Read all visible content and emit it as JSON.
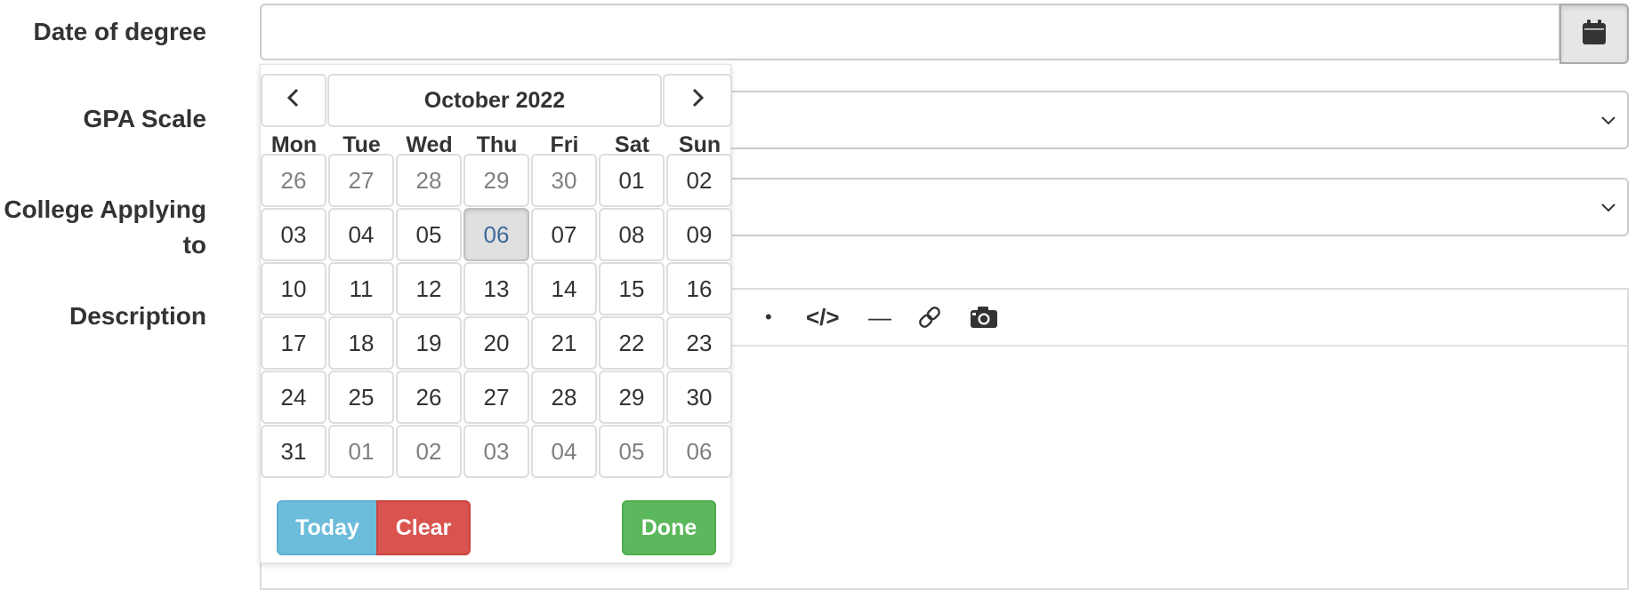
{
  "form": {
    "date_label": "Date of degree",
    "date_value": "",
    "gpa_label": "GPA Scale",
    "gpa_value": "",
    "college_label_line1": "College Applying",
    "college_label_line2": "to",
    "college_value": "",
    "description_label": "Description"
  },
  "editor": {
    "toolbar": {
      "bullet": "•",
      "code": "</>",
      "hr": "—",
      "link": "🔗",
      "image": "📷"
    }
  },
  "datepicker": {
    "prev_glyph": "‹",
    "next_glyph": "›",
    "month_year": "October 2022",
    "weekdays": [
      "Mon",
      "Tue",
      "Wed",
      "Thu",
      "Fri",
      "Sat",
      "Sun"
    ],
    "weeks": [
      [
        "26",
        "27",
        "28",
        "29",
        "30",
        "01",
        "02"
      ],
      [
        "03",
        "04",
        "05",
        "06",
        "07",
        "08",
        "09"
      ],
      [
        "10",
        "11",
        "12",
        "13",
        "14",
        "15",
        "16"
      ],
      [
        "17",
        "18",
        "19",
        "20",
        "21",
        "22",
        "23"
      ],
      [
        "24",
        "25",
        "26",
        "27",
        "28",
        "29",
        "30"
      ],
      [
        "31",
        "01",
        "02",
        "03",
        "04",
        "05",
        "06"
      ]
    ],
    "today": "06",
    "today_label": "Today",
    "clear_label": "Clear",
    "done_label": "Done"
  },
  "colors": {
    "today_button": "#6cbcdb",
    "clear_button": "#d9534f",
    "done_button": "#5cb85c",
    "today_cell_text": "#3c6b9c",
    "muted_day_text": "#808080"
  },
  "icons": {
    "calendar": "calendar-icon",
    "chevron": "chevron-down-icon",
    "prev": "chevron-left-icon",
    "next": "chevron-right-icon"
  }
}
